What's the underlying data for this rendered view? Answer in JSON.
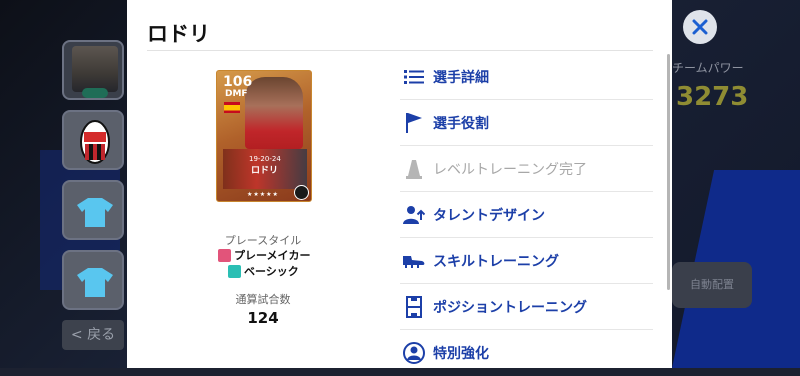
{
  "background": {
    "team_power_label": "チームパワー",
    "team_power_value": "3273",
    "auto_button": "自動配置",
    "back_button": "< 戻る"
  },
  "modal": {
    "title": "ロドリ",
    "player_card": {
      "rating": "106",
      "position": "DMF",
      "year": "19-20-24",
      "name": "ロドリ",
      "stars": "★★★★★"
    },
    "playstyle_label": "プレースタイル",
    "playstyles": [
      "プレーメイカー",
      "ベーシック"
    ],
    "matches_label": "通算試合数",
    "matches_value": "124",
    "menu": [
      {
        "label": "選手詳細",
        "icon": "list-icon",
        "enabled": true
      },
      {
        "label": "選手役割",
        "icon": "flag-icon",
        "enabled": true
      },
      {
        "label": "レベルトレーニング完了",
        "icon": "cone-icon",
        "enabled": false
      },
      {
        "label": "タレントデザイン",
        "icon": "person-up-icon",
        "enabled": true
      },
      {
        "label": "スキルトレーニング",
        "icon": "boot-icon",
        "enabled": true
      },
      {
        "label": "ポジショントレーニング",
        "icon": "pitch-icon",
        "enabled": true
      },
      {
        "label": "特別強化",
        "icon": "person-circle-icon",
        "enabled": true
      }
    ]
  },
  "colors": {
    "accent": "#1c3fa8",
    "disabled": "#a7a7a7",
    "team_power": "#8f8c33"
  }
}
